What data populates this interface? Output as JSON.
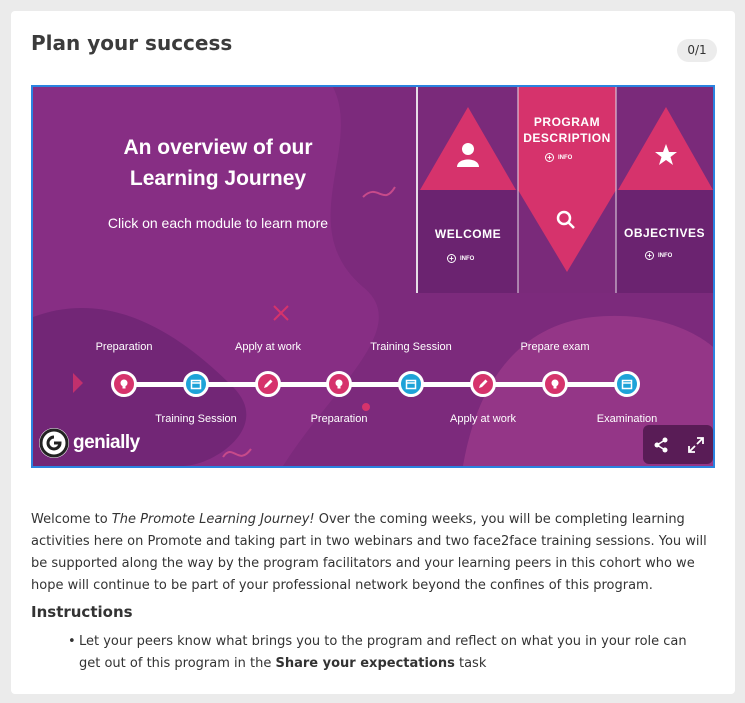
{
  "page": {
    "title": "Plan your success",
    "counter": "0/1"
  },
  "embed": {
    "overview_title_line1": "An overview of our",
    "overview_title_line2": "Learning Journey",
    "overview_subtitle": "Click on each module to learn more",
    "modules": {
      "program_description_line1": "PROGRAM",
      "program_description_line2": "DESCRIPTION",
      "welcome": "WELCOME",
      "objectives": "OBJECTIVES",
      "info_label": "INFO"
    },
    "timeline_top": [
      "Preparation",
      "Apply at work",
      "Training Session",
      "Prepare exam"
    ],
    "timeline_bottom": [
      "Training Session",
      "Preparation",
      "Apply at work",
      "Examination"
    ],
    "logo_text": "genially",
    "colors": {
      "pink": "#d6336c",
      "blue": "#1ea3d8",
      "purple": "#7a2a7a",
      "dark_purple": "#5b1f6b"
    }
  },
  "intro": {
    "welcome_prefix": "Welcome to ",
    "journey_name": "The Promote Learning Journey!",
    "welcome_rest": " Over the coming weeks, you will be completing learning activities here on Promote and taking part in two webinars and two face2face training sessions. You will be supported along the way by the program facilitators and your learning peers in this cohort who we hope will continue to be part of your professional network beyond the confines of this program."
  },
  "instructions": {
    "heading": "Instructions",
    "bullet_prefix": "Let your peers know what brings you to the program and reflect on what you in your role can get out of this program in the ",
    "bullet_bold": "Share your expectations",
    "bullet_suffix": " task"
  }
}
